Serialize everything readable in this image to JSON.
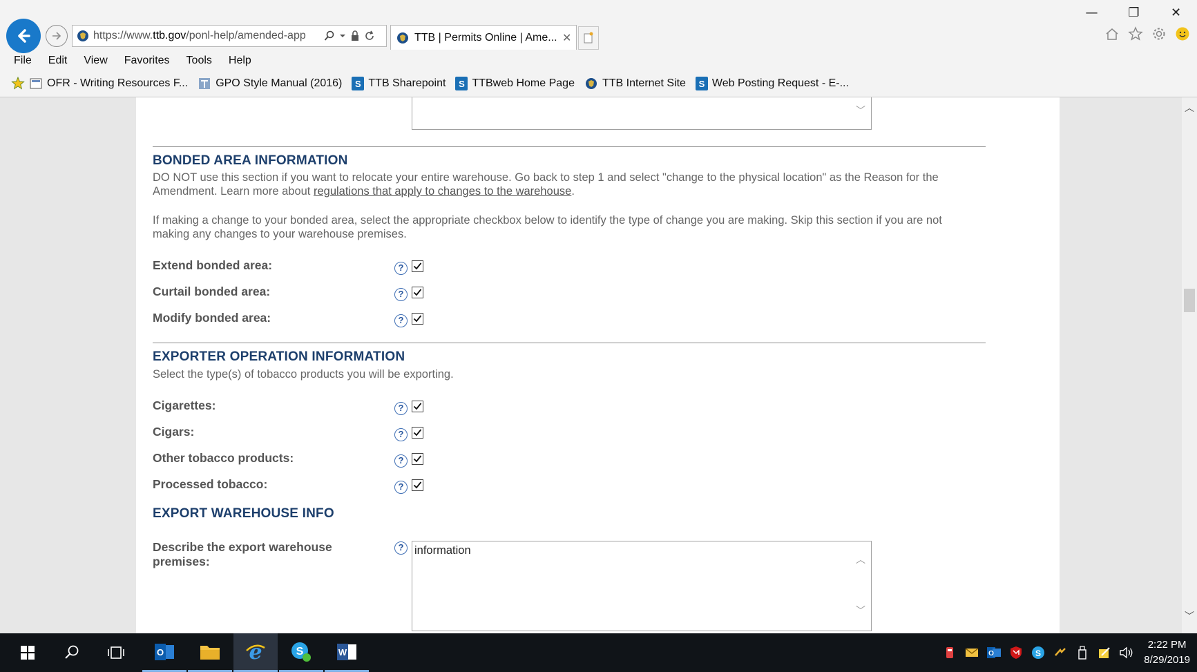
{
  "window": {
    "minimize": "—",
    "restore": "❐",
    "close": "✕"
  },
  "address_bar": {
    "url_prefix": "https://www.",
    "url_domain": "ttb.gov",
    "url_rest": "/ponl-help/amended-app"
  },
  "tab": {
    "title": "TTB | Permits Online | Ame...",
    "close": "✕"
  },
  "menu": [
    "File",
    "Edit",
    "View",
    "Favorites",
    "Tools",
    "Help"
  ],
  "favorites": [
    {
      "label": "OFR - Writing Resources F...",
      "icon": "document-icon"
    },
    {
      "label": "GPO Style Manual (2016)",
      "icon": "gpo-icon"
    },
    {
      "label": "TTB Sharepoint",
      "icon": "sharepoint-icon"
    },
    {
      "label": "TTBweb Home Page",
      "icon": "sharepoint-icon"
    },
    {
      "label": "TTB Internet Site",
      "icon": "ttb-shield-icon"
    },
    {
      "label": "Web Posting Request - E-...",
      "icon": "sharepoint-icon"
    }
  ],
  "bonded": {
    "title": "BONDED AREA INFORMATION",
    "para1_a": "DO NOT use this section if you want to relocate your entire warehouse. Go back to step 1 and select \"change to the physical location\" as the Reason for the Amendment. Learn more about ",
    "para1_link": "regulations that apply to changes to the warehouse",
    "para1_b": ".",
    "para2": "If making a change to your bonded area, select the appropriate checkbox below to identify the type of change you are making. Skip this section if you are not making any changes to your warehouse premises.",
    "fields": [
      {
        "label": "Extend bonded area:",
        "checked": true
      },
      {
        "label": "Curtail bonded area:",
        "checked": true
      },
      {
        "label": "Modify bonded area:",
        "checked": true
      }
    ]
  },
  "exporter": {
    "title": "EXPORTER OPERATION INFORMATION",
    "para": "Select the type(s) of tobacco products you will be exporting.",
    "fields": [
      {
        "label": "Cigarettes:",
        "checked": true
      },
      {
        "label": "Cigars:",
        "checked": true
      },
      {
        "label": "Other tobacco products:",
        "checked": true
      },
      {
        "label": "Processed tobacco:",
        "checked": true
      }
    ]
  },
  "warehouse": {
    "title": "EXPORT WAREHOUSE INFO",
    "label_line1": "Describe the export warehouse",
    "label_line2": "premises:",
    "value": "information"
  },
  "help_glyph": "?",
  "clock": {
    "time": "2:22 PM",
    "date": "8/29/2019"
  },
  "colors": {
    "section_title": "#1d3f6c",
    "back_button": "#1979ca",
    "taskbar": "#101418"
  }
}
